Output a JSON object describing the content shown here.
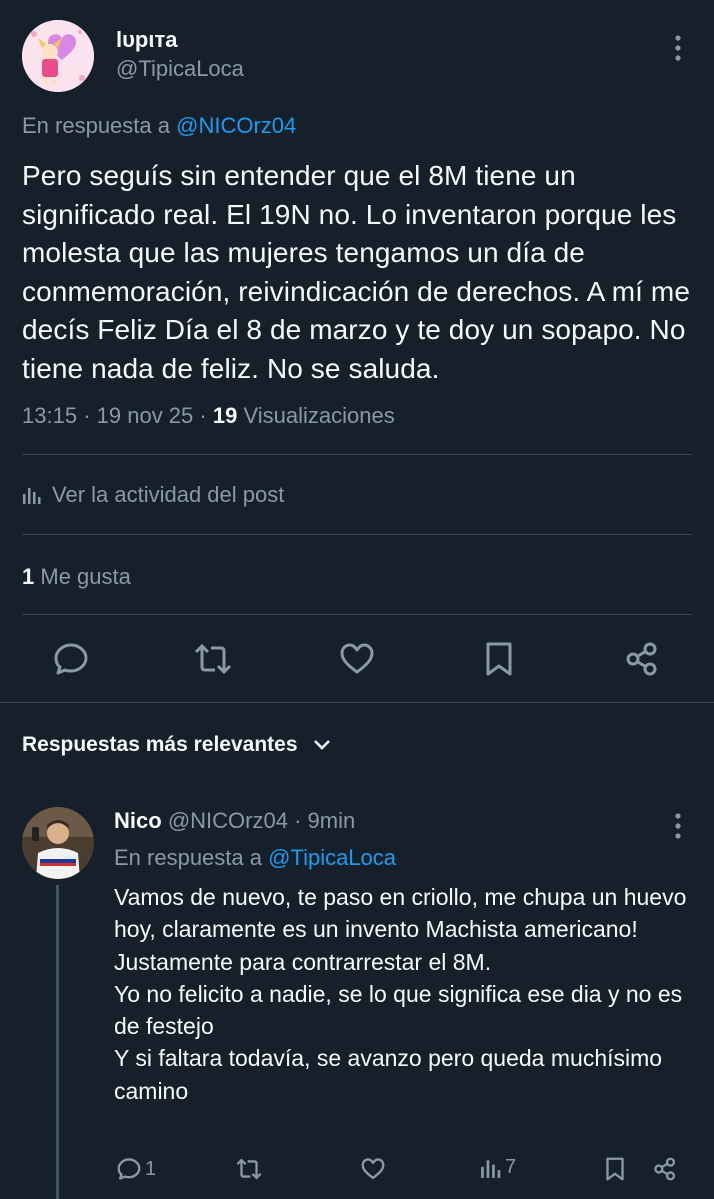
{
  "post": {
    "author_name": "lυpιтa",
    "author_handle": "@TipicaLoca",
    "reply_prefix": "En respuesta a",
    "reply_to": "@NICOrz04",
    "text": "Pero seguís sin entender que el 8M tiene un significado real. El 19N no. Lo inventaron porque les molesta que las mujeres tengamos un día de conmemoración, reivindicación de derechos. A mí me decís Feliz Día el 8 de marzo y te doy un sopapo. No tiene nada de feliz. No se saluda.",
    "time": "13:15",
    "date": "19 nov 25",
    "sep": "·",
    "views_count": "19",
    "views_label": "Visualizaciones",
    "activity_label": "Ver la actividad del post",
    "likes_count": "1",
    "likes_label": "Me gusta"
  },
  "actions": {
    "icons": [
      "reply-icon",
      "repost-icon",
      "like-icon",
      "bookmark-icon",
      "share-icon"
    ]
  },
  "replies_header": {
    "label": "Respuestas más relevantes"
  },
  "reply": {
    "author_name": "Nico",
    "author_handle": "@NICOrz04",
    "sep": "·",
    "time_ago": "9min",
    "reply_prefix": "En respuesta a",
    "reply_to": "@TipicaLoca",
    "lines": [
      "Vamos de nuevo, te paso en criollo, me chupa un huevo hoy, claramente es un invento Machista americano!",
      "Justamente para contrarrestar el 8M.",
      "Yo no felicito a nadie, se lo que significa ese dia y no es de festejo",
      "Y si faltara todavía, se avanzo pero queda muchísimo camino"
    ],
    "reply_count": "1",
    "views_count": "7"
  },
  "colors": {
    "background": "#15202b",
    "text": "#f7f9f9",
    "muted": "#8b98a5",
    "link": "#1d9bf0",
    "divider": "#38444d"
  }
}
